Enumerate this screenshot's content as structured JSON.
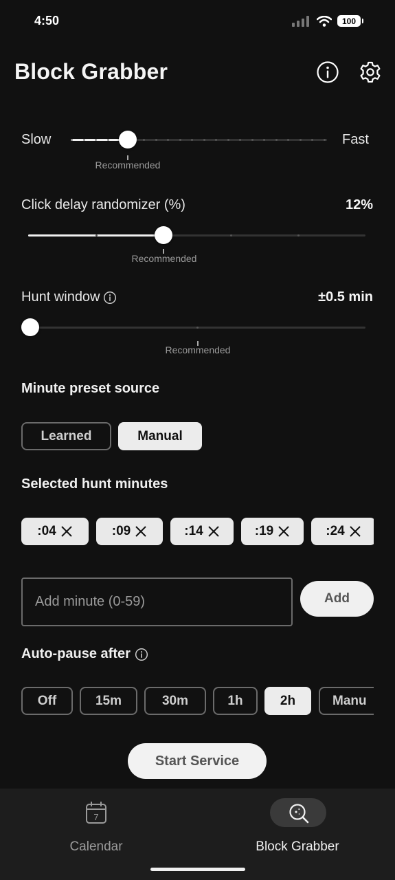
{
  "status": {
    "time": "4:50",
    "battery": "100"
  },
  "header": {
    "title": "Block Grabber"
  },
  "speed": {
    "left_label": "Slow",
    "right_label": "Fast",
    "recommended": "Recommended",
    "level": 0.2
  },
  "click_delay": {
    "label": "Click delay randomizer (%)",
    "value": "12%",
    "recommended": "Recommended",
    "level": 0.4
  },
  "hunt_window": {
    "label": "Hunt window",
    "value": "±0.5 min",
    "recommended": "Recommended",
    "level": 0.0
  },
  "preset_source": {
    "title": "Minute preset source",
    "options": [
      "Learned",
      "Manual"
    ],
    "selected": "Manual"
  },
  "selected_minutes": {
    "title": "Selected hunt minutes",
    "chips": [
      ":04",
      ":09",
      ":14",
      ":19",
      ":24"
    ]
  },
  "add_minute": {
    "placeholder": "Add minute (0-59)",
    "button": "Add"
  },
  "auto_pause": {
    "title": "Auto-pause after",
    "options": [
      "Off",
      "15m",
      "30m",
      "1h",
      "2h",
      "Manu"
    ],
    "selected": "2h"
  },
  "start_button": "Start Service",
  "tabs": [
    {
      "label": "Calendar",
      "icon": "calendar-icon",
      "active": false
    },
    {
      "label": "Block Grabber",
      "icon": "block-grabber-icon",
      "active": true
    }
  ],
  "colors": {
    "background": "#111111",
    "surface": "#1d1d1d",
    "accent": "#f0f0f0"
  }
}
